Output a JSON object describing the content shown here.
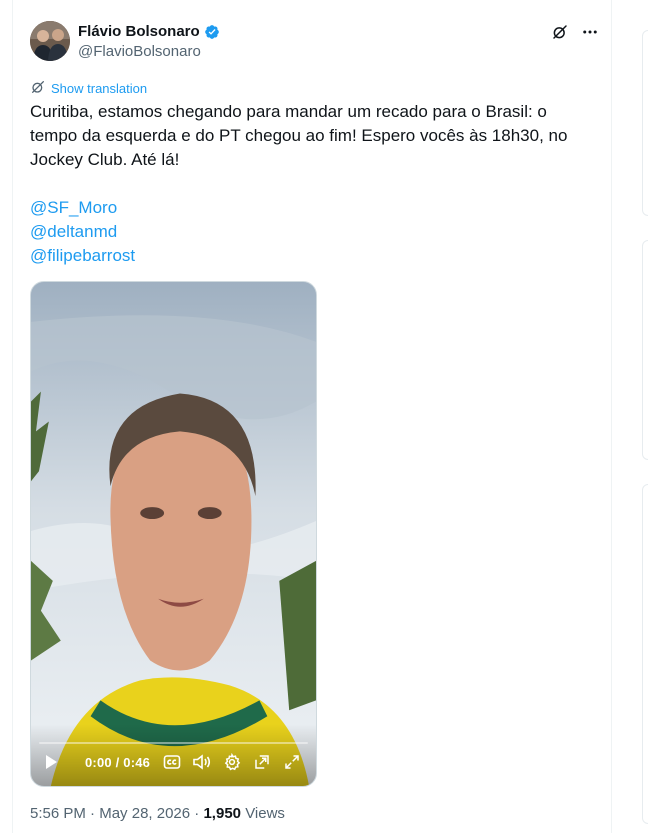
{
  "author": {
    "display_name": "Flávio Bolsonaro",
    "handle": "@FlavioBolsonaro",
    "verified": true
  },
  "header_icons": [
    "grok-icon",
    "more-options-icon"
  ],
  "translation_link": "Show translation",
  "tweet_text": "Curitiba, estamos chegando para mandar um recado para o Brasil: o tempo da esquerda e do PT chegou ao fim! Espero vocês às 18h30, no Jockey Club. Até lá!",
  "mentions": [
    "@SF_Moro",
    "@deltanmd",
    "@filipebarrost"
  ],
  "video": {
    "current_time": "0:00",
    "duration": "0:46",
    "time_separator": " / ",
    "progress": 0,
    "controls": [
      "play-icon",
      "captions-icon",
      "volume-icon",
      "settings-icon",
      "pip-icon",
      "fullscreen-icon"
    ]
  },
  "meta": {
    "time": "5:56 PM",
    "date": "May 28, 2026",
    "separator": " · ",
    "views_count": "1,950",
    "views_label": "Views"
  },
  "colors": {
    "link": "#1d9bf0",
    "secondary_text": "#536471",
    "primary_text": "#0f1419"
  }
}
